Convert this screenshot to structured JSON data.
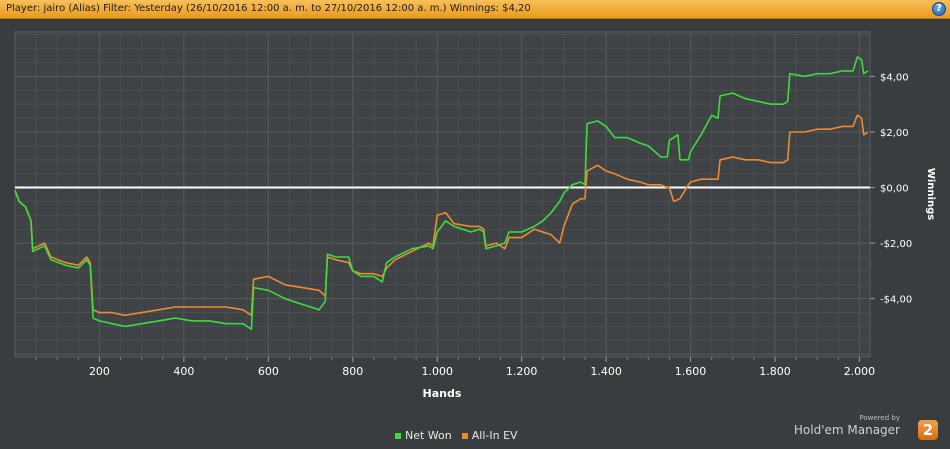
{
  "header": {
    "text": "Player: jairo (Alias) Filter: Yesterday (26/10/2016 12:00 a. m. to 27/10/2016 12:00 a. m.) Winnings: $4,20",
    "help_label": "?"
  },
  "legend": {
    "items": [
      {
        "label": "Net Won",
        "color": "#3ddc3d"
      },
      {
        "label": "All-In EV",
        "color": "#f08a2e"
      }
    ]
  },
  "branding": {
    "powered_by": "Powered by",
    "product": "Hold'em Manager",
    "logo_text": "2"
  },
  "chart_data": {
    "type": "line",
    "xlabel": "Hands",
    "ylabel": "Winnings",
    "xlim": [
      0,
      2025
    ],
    "ylim": [
      -6.1,
      5.6
    ],
    "x_ticks": [
      200,
      400,
      600,
      800,
      1000,
      1200,
      1400,
      1600,
      1800,
      2000
    ],
    "x_tick_labels": [
      "200",
      "400",
      "600",
      "800",
      "1.000",
      "1.200",
      "1.400",
      "1.600",
      "1.800",
      "2.000"
    ],
    "y_ticks": [
      4,
      2,
      0,
      -2,
      -4
    ],
    "y_tick_labels": [
      "$4,00",
      "$2,00",
      "$0,00",
      "-$2,00",
      "-$4,00"
    ],
    "grid": true,
    "zero_line": true,
    "series": [
      {
        "name": "Net Won",
        "color": "#3ddc3d",
        "points": [
          [
            0,
            -0.1
          ],
          [
            10,
            -0.5
          ],
          [
            25,
            -0.7
          ],
          [
            38,
            -1.2
          ],
          [
            42,
            -2.3
          ],
          [
            70,
            -2.1
          ],
          [
            85,
            -2.6
          ],
          [
            120,
            -2.8
          ],
          [
            150,
            -2.9
          ],
          [
            170,
            -2.6
          ],
          [
            178,
            -2.8
          ],
          [
            185,
            -4.7
          ],
          [
            200,
            -4.8
          ],
          [
            230,
            -4.9
          ],
          [
            260,
            -5.0
          ],
          [
            300,
            -4.9
          ],
          [
            340,
            -4.8
          ],
          [
            380,
            -4.7
          ],
          [
            420,
            -4.8
          ],
          [
            460,
            -4.8
          ],
          [
            500,
            -4.9
          ],
          [
            540,
            -4.9
          ],
          [
            560,
            -5.1
          ],
          [
            565,
            -3.6
          ],
          [
            600,
            -3.7
          ],
          [
            640,
            -4.0
          ],
          [
            680,
            -4.2
          ],
          [
            720,
            -4.4
          ],
          [
            735,
            -4.1
          ],
          [
            740,
            -2.4
          ],
          [
            760,
            -2.5
          ],
          [
            790,
            -2.5
          ],
          [
            800,
            -3.0
          ],
          [
            820,
            -3.2
          ],
          [
            850,
            -3.2
          ],
          [
            870,
            -3.4
          ],
          [
            880,
            -2.7
          ],
          [
            900,
            -2.5
          ],
          [
            940,
            -2.2
          ],
          [
            980,
            -2.1
          ],
          [
            990,
            -2.2
          ],
          [
            1000,
            -1.6
          ],
          [
            1020,
            -1.2
          ],
          [
            1040,
            -1.4
          ],
          [
            1080,
            -1.6
          ],
          [
            1100,
            -1.5
          ],
          [
            1110,
            -1.6
          ],
          [
            1115,
            -2.2
          ],
          [
            1140,
            -2.1
          ],
          [
            1160,
            -2.0
          ],
          [
            1170,
            -1.6
          ],
          [
            1200,
            -1.6
          ],
          [
            1230,
            -1.4
          ],
          [
            1250,
            -1.2
          ],
          [
            1270,
            -0.9
          ],
          [
            1290,
            -0.5
          ],
          [
            1300,
            -0.2
          ],
          [
            1320,
            0.1
          ],
          [
            1340,
            0.2
          ],
          [
            1350,
            0.1
          ],
          [
            1355,
            2.3
          ],
          [
            1380,
            2.4
          ],
          [
            1400,
            2.2
          ],
          [
            1420,
            1.8
          ],
          [
            1450,
            1.8
          ],
          [
            1480,
            1.6
          ],
          [
            1500,
            1.5
          ],
          [
            1530,
            1.1
          ],
          [
            1545,
            1.1
          ],
          [
            1550,
            1.7
          ],
          [
            1570,
            1.9
          ],
          [
            1575,
            1.0
          ],
          [
            1595,
            1.0
          ],
          [
            1600,
            1.3
          ],
          [
            1625,
            1.9
          ],
          [
            1650,
            2.6
          ],
          [
            1665,
            2.5
          ],
          [
            1670,
            3.3
          ],
          [
            1700,
            3.4
          ],
          [
            1730,
            3.2
          ],
          [
            1760,
            3.1
          ],
          [
            1790,
            3.0
          ],
          [
            1820,
            3.0
          ],
          [
            1830,
            3.1
          ],
          [
            1835,
            4.1
          ],
          [
            1870,
            4.0
          ],
          [
            1900,
            4.1
          ],
          [
            1930,
            4.1
          ],
          [
            1960,
            4.2
          ],
          [
            1985,
            4.2
          ],
          [
            1995,
            4.7
          ],
          [
            2005,
            4.6
          ],
          [
            2010,
            4.1
          ],
          [
            2020,
            4.2
          ]
        ]
      },
      {
        "name": "All-In EV",
        "color": "#f08a2e",
        "points": [
          [
            0,
            -0.1
          ],
          [
            10,
            -0.5
          ],
          [
            25,
            -0.7
          ],
          [
            38,
            -1.2
          ],
          [
            42,
            -2.2
          ],
          [
            70,
            -2.0
          ],
          [
            85,
            -2.5
          ],
          [
            120,
            -2.7
          ],
          [
            150,
            -2.8
          ],
          [
            170,
            -2.5
          ],
          [
            178,
            -2.7
          ],
          [
            185,
            -4.4
          ],
          [
            200,
            -4.5
          ],
          [
            230,
            -4.5
          ],
          [
            260,
            -4.6
          ],
          [
            300,
            -4.5
          ],
          [
            340,
            -4.4
          ],
          [
            380,
            -4.3
          ],
          [
            420,
            -4.3
          ],
          [
            460,
            -4.3
          ],
          [
            500,
            -4.3
          ],
          [
            540,
            -4.4
          ],
          [
            560,
            -4.6
          ],
          [
            565,
            -3.3
          ],
          [
            600,
            -3.2
          ],
          [
            640,
            -3.5
          ],
          [
            680,
            -3.6
          ],
          [
            720,
            -3.7
          ],
          [
            735,
            -3.9
          ],
          [
            740,
            -2.5
          ],
          [
            760,
            -2.6
          ],
          [
            790,
            -2.7
          ],
          [
            800,
            -3.0
          ],
          [
            820,
            -3.1
          ],
          [
            850,
            -3.1
          ],
          [
            870,
            -3.2
          ],
          [
            880,
            -2.9
          ],
          [
            900,
            -2.6
          ],
          [
            940,
            -2.3
          ],
          [
            980,
            -2.0
          ],
          [
            990,
            -2.1
          ],
          [
            1000,
            -1.0
          ],
          [
            1020,
            -0.9
          ],
          [
            1040,
            -1.3
          ],
          [
            1080,
            -1.4
          ],
          [
            1100,
            -1.4
          ],
          [
            1110,
            -1.5
          ],
          [
            1115,
            -2.1
          ],
          [
            1140,
            -2.0
          ],
          [
            1160,
            -2.2
          ],
          [
            1170,
            -1.8
          ],
          [
            1200,
            -1.8
          ],
          [
            1230,
            -1.5
          ],
          [
            1250,
            -1.6
          ],
          [
            1270,
            -1.7
          ],
          [
            1290,
            -2.0
          ],
          [
            1300,
            -1.4
          ],
          [
            1320,
            -0.6
          ],
          [
            1340,
            -0.4
          ],
          [
            1350,
            -0.4
          ],
          [
            1355,
            0.6
          ],
          [
            1380,
            0.8
          ],
          [
            1400,
            0.6
          ],
          [
            1420,
            0.5
          ],
          [
            1450,
            0.3
          ],
          [
            1480,
            0.2
          ],
          [
            1500,
            0.1
          ],
          [
            1530,
            0.1
          ],
          [
            1545,
            0.0
          ],
          [
            1550,
            0.0
          ],
          [
            1560,
            -0.5
          ],
          [
            1575,
            -0.4
          ],
          [
            1595,
            0.1
          ],
          [
            1600,
            0.2
          ],
          [
            1625,
            0.3
          ],
          [
            1650,
            0.3
          ],
          [
            1665,
            0.3
          ],
          [
            1670,
            1.0
          ],
          [
            1700,
            1.1
          ],
          [
            1730,
            1.0
          ],
          [
            1760,
            1.0
          ],
          [
            1790,
            0.9
          ],
          [
            1820,
            0.9
          ],
          [
            1830,
            1.0
          ],
          [
            1835,
            2.0
          ],
          [
            1870,
            2.0
          ],
          [
            1900,
            2.1
          ],
          [
            1930,
            2.1
          ],
          [
            1960,
            2.2
          ],
          [
            1985,
            2.2
          ],
          [
            1995,
            2.6
          ],
          [
            2005,
            2.5
          ],
          [
            2010,
            1.9
          ],
          [
            2020,
            2.0
          ]
        ]
      }
    ]
  }
}
